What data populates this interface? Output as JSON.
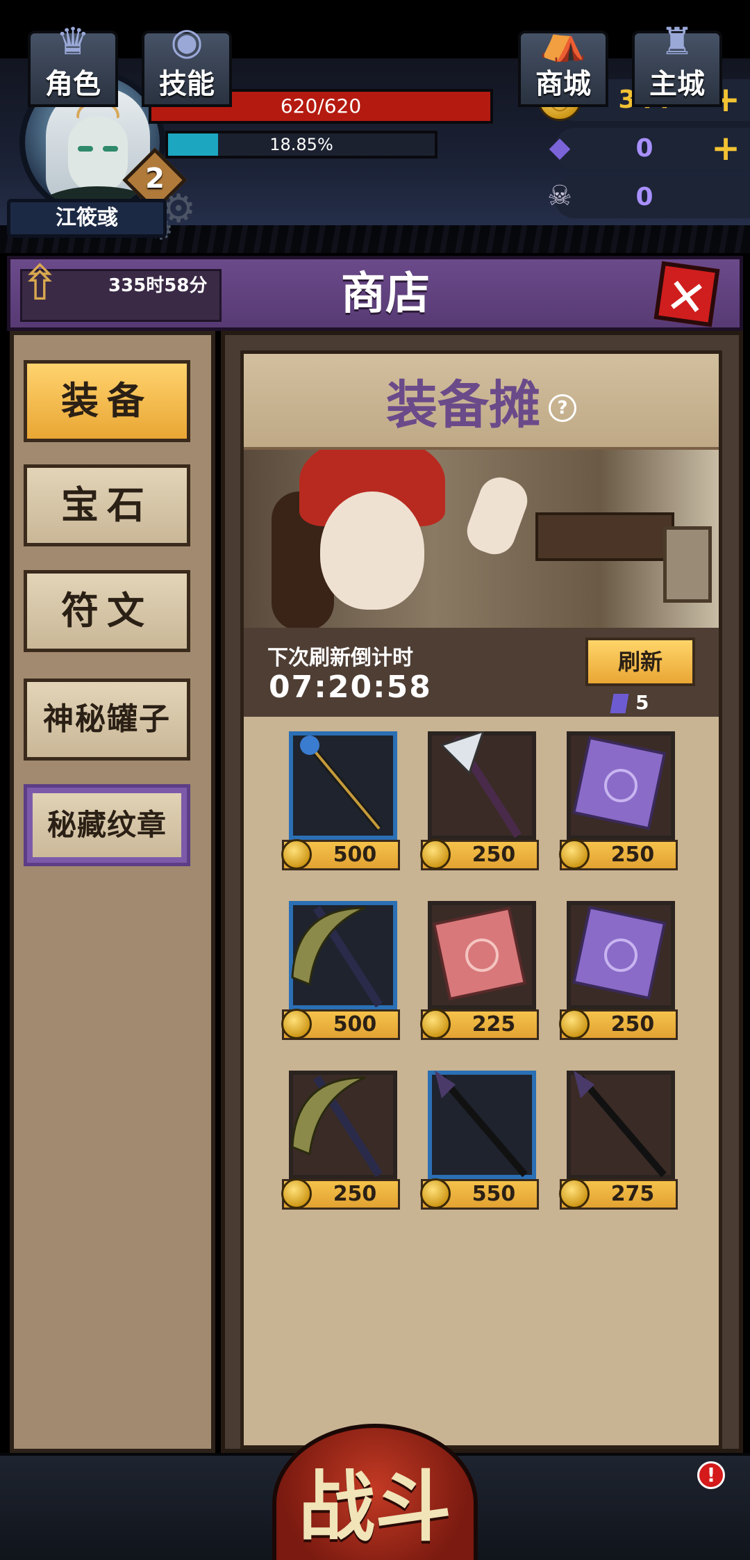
{
  "player": {
    "name": "江筱彧",
    "level": "2",
    "hp_text": "620/620",
    "hp_fraction": 1.0,
    "xp_text": "18.85%",
    "xp_fraction": 0.1885
  },
  "resources": [
    {
      "icon": "gold-coin-icon",
      "value": "344",
      "has_plus": true
    },
    {
      "icon": "purple-gem-icon",
      "value": "0",
      "has_plus": true
    },
    {
      "icon": "ram-skull-icon",
      "value": "0",
      "has_plus": false
    }
  ],
  "shop": {
    "timer": "335时58分",
    "title": "商店",
    "tabs": [
      {
        "label": "装备",
        "active": true
      },
      {
        "label": "宝石",
        "active": false
      },
      {
        "label": "符文",
        "active": false
      },
      {
        "label": "神秘罐子",
        "active": false
      },
      {
        "label": "秘藏纹章",
        "active": false
      }
    ],
    "stall_title": "装备摊",
    "help_glyph": "?",
    "refresh_label": "下次刷新倒计时",
    "refresh_time": "07:20:58",
    "refresh_button": "刷新",
    "refresh_cost": "5",
    "items": [
      {
        "kind": "staff",
        "frame": "blue",
        "price": "500"
      },
      {
        "kind": "axe",
        "frame": "dark",
        "price": "250"
      },
      {
        "kind": "purple-scroll",
        "frame": "dark",
        "price": "250"
      },
      {
        "kind": "scythe",
        "frame": "blue",
        "price": "500"
      },
      {
        "kind": "red-scroll",
        "frame": "dark",
        "price": "225"
      },
      {
        "kind": "purple-scroll",
        "frame": "dark",
        "price": "250"
      },
      {
        "kind": "scythe",
        "frame": "dark",
        "price": "250"
      },
      {
        "kind": "spear",
        "frame": "blue",
        "price": "550"
      },
      {
        "kind": "spear",
        "frame": "dark",
        "price": "275"
      }
    ]
  },
  "nav": {
    "role": "角色",
    "skills": "技能",
    "battle": "战斗",
    "mall": "商城",
    "main_city": "主城",
    "alert": "!"
  },
  "colors": {
    "hp": "#b51a10",
    "xp": "#1da6c0",
    "purple_bar": "#6b4a8a",
    "gold": "#f2c233",
    "blue_frame": "#2b6fb4"
  }
}
